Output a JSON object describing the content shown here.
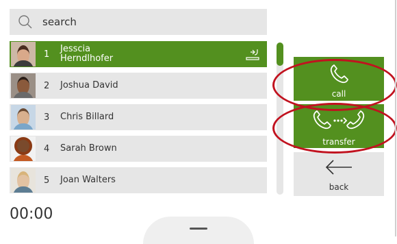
{
  "search": {
    "placeholder": "search"
  },
  "contacts": [
    {
      "index": "1",
      "first": "Jesscia",
      "last": "Herndlhofer",
      "selected": true
    },
    {
      "index": "2",
      "name": "Joshua David"
    },
    {
      "index": "3",
      "name": "Chris Billard"
    },
    {
      "index": "4",
      "name": "Sarah Brown"
    },
    {
      "index": "5",
      "name": "Joan Walters"
    }
  ],
  "actions": {
    "call_label": "call",
    "transfer_label": "transfer",
    "back_label": "back"
  },
  "timer": "00:00",
  "colors": {
    "accent": "#53901f",
    "highlight": "#c1121f"
  },
  "icons": [
    "search-icon",
    "phone-icon",
    "transfer-icon",
    "back-arrow-icon"
  ]
}
